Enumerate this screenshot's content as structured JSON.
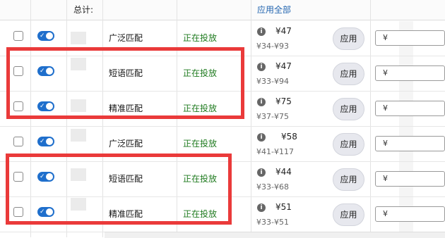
{
  "header": {
    "total_label": "总计:",
    "apply_all_label": "应用全部"
  },
  "rows": [
    {
      "match": "广泛匹配",
      "status": "正在投放",
      "bid": "¥47",
      "range": "¥34-¥93",
      "apply": "应用",
      "currency": "¥"
    },
    {
      "match": "短语匹配",
      "status": "正在投放",
      "bid": "¥47",
      "range": "¥33-¥94",
      "apply": "应用",
      "currency": "¥"
    },
    {
      "match": "精准匹配",
      "status": "正在投放",
      "bid": "¥75",
      "range": "¥37-¥75",
      "apply": "应用",
      "currency": "¥"
    },
    {
      "match": "广泛匹配",
      "status": "正在投放",
      "bid": "¥58",
      "range": "¥41-¥117",
      "apply": "应用",
      "currency": "¥"
    },
    {
      "match": "短语匹配",
      "status": "正在投放",
      "bid": "¥44",
      "range": "¥33-¥68",
      "apply": "应用",
      "currency": "¥"
    },
    {
      "match": "精准匹配",
      "status": "正在投放",
      "bid": "¥51",
      "range": "¥33-¥51",
      "apply": "应用",
      "currency": "¥"
    }
  ],
  "colors": {
    "accent": "#1f6fcc",
    "status_green": "#1e7a1e",
    "highlight_red": "#ea3a3a",
    "link_blue": "#2466b0"
  },
  "icons": {
    "info": "info-icon",
    "toggle": "toggle-switch"
  }
}
